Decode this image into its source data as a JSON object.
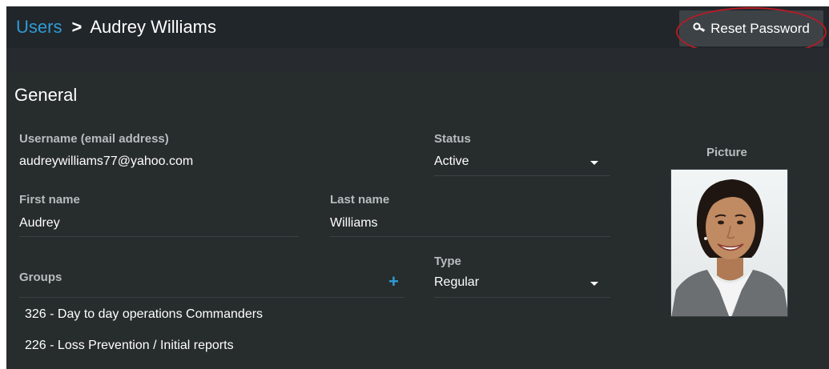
{
  "header": {
    "breadcrumb_parent": "Users",
    "breadcrumb_separator": ">",
    "breadcrumb_current": "Audrey Williams",
    "reset_label": "Reset Password",
    "reset_icon": "key-icon"
  },
  "general": {
    "title": "General",
    "username_label": "Username (email address)",
    "username_value": "audreywilliams77@yahoo.com",
    "status_label": "Status",
    "status_value": "Active",
    "first_name_label": "First name",
    "first_name_value": "Audrey",
    "last_name_label": "Last name",
    "last_name_value": "Williams",
    "groups_label": "Groups",
    "type_label": "Type",
    "type_value": "Regular",
    "picture_label": "Picture",
    "groups": [
      "326 - Day to day operations Commanders",
      "226 - Loss Prevention / Initial reports"
    ]
  },
  "colors": {
    "accent": "#2e9bd6",
    "background": "#272c2c",
    "header": "#21262a",
    "highlight_circle": "#b51c24"
  }
}
